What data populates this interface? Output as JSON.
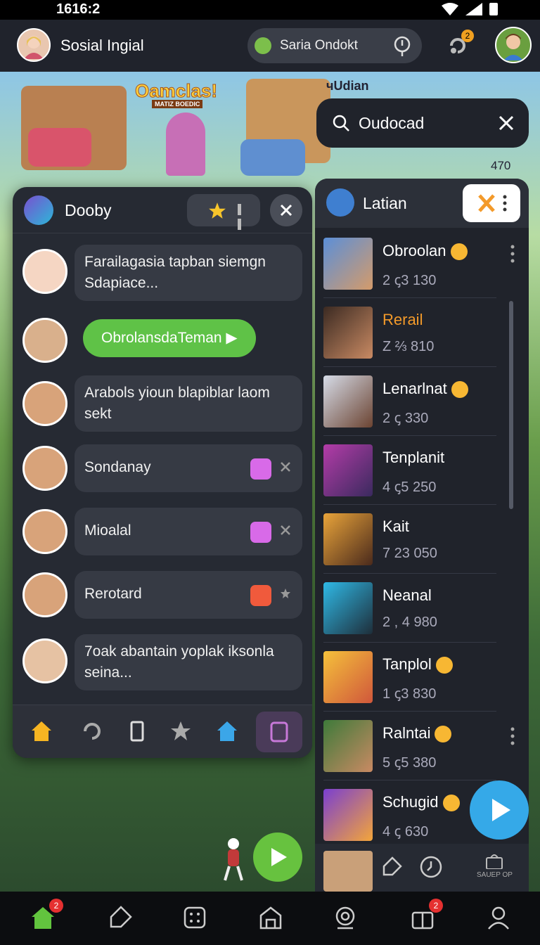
{
  "status_bar": {
    "time": "1616:2"
  },
  "header": {
    "app_name": "Sosial Ingial",
    "pill_label": "Saria Ondokt",
    "notifications_count": "2"
  },
  "banner": {
    "logo_text": "Oamclas!",
    "logo_sub": "MATIZ BOEDIC",
    "corner_label": "чUdian",
    "count": "470"
  },
  "search": {
    "value": "Oudocad"
  },
  "chat": {
    "title": "Dooby",
    "messages": [
      {
        "text": "Farailagasia tapban siemgn",
        "text2": "Sdapiace...",
        "type": "incoming"
      },
      {
        "text": "ObrolansdaTeman ▶",
        "type": "green"
      },
      {
        "text": "Arabols yioun blapiblar laom sekt",
        "type": "incoming"
      },
      {
        "text": "Sondanay",
        "type": "check",
        "check_color": "purple"
      },
      {
        "text": "Mioalal",
        "type": "check",
        "check_color": "purple"
      },
      {
        "text": "Rerotard",
        "type": "check",
        "check_color": "red"
      },
      {
        "text": "7oak abantain yoplak iksonla seina...",
        "type": "incoming"
      }
    ],
    "tabs": [
      "home-icon",
      "refresh-icon",
      "cup-icon",
      "star-icon",
      "house-icon",
      "note-icon"
    ]
  },
  "leaderboard": {
    "title": "Latian",
    "rows": [
      {
        "name": "Obroolan",
        "score": "2  ꞔ3 130",
        "smile": true,
        "more": true
      },
      {
        "name": "Rerail",
        "score": "Z  ⅔ 810",
        "orange": true
      },
      {
        "name": "Lenarlnat",
        "score": "2  ꞔ 330",
        "smile": true
      },
      {
        "name": "Tenplanit",
        "score": "4  ꞔ5 250"
      },
      {
        "name": "Kait",
        "score": "7  23 050"
      },
      {
        "name": "Neanal",
        "score": "2 , 4  980"
      },
      {
        "name": "Tanplol",
        "score": "1  ꞔ3 830",
        "smile": true
      },
      {
        "name": "Ralntai",
        "score": "5  ꞔ5 380",
        "smile": true,
        "more": true
      },
      {
        "name": "Schugid",
        "score": "4  ꞔ 630",
        "smile": true
      }
    ],
    "footer_label": "SAUEP OP"
  },
  "bottom_nav": {
    "badge_home": "2",
    "badge_gift": "2"
  },
  "colors": {
    "accent_green": "#5fc247",
    "accent_blue": "#35a9e8",
    "panel": "#262a33"
  }
}
